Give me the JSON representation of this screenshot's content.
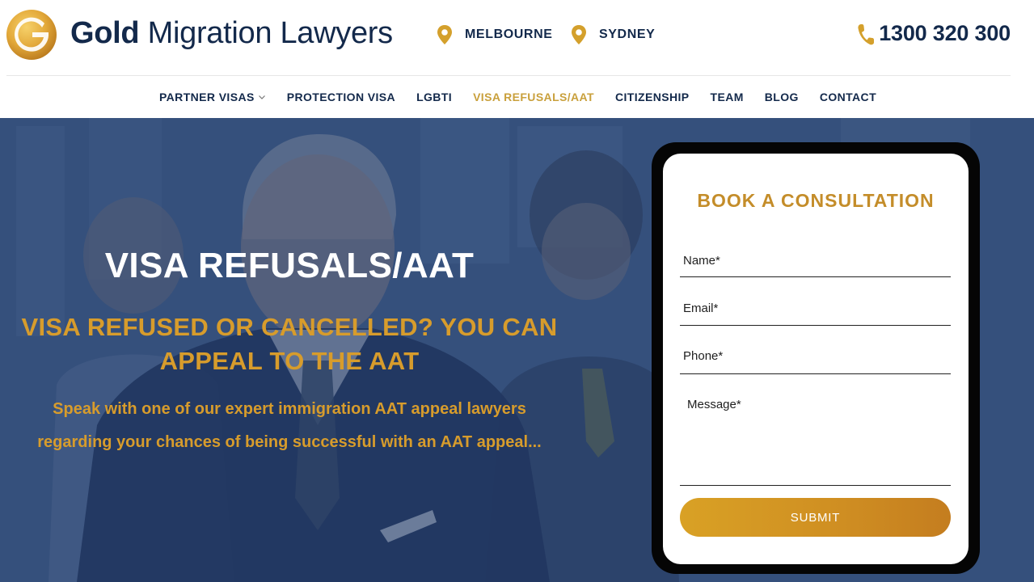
{
  "brand": {
    "name_bold": "Gold",
    "name_rest": "Migration Lawyers",
    "logo_letter": "G",
    "gold_color": "#d4a02c",
    "navy_color": "#13294b"
  },
  "locations": [
    {
      "icon": "map-pin-icon",
      "label": "MELBOURNE"
    },
    {
      "icon": "map-pin-icon",
      "label": "SYDNEY"
    }
  ],
  "phone": {
    "icon": "phone-icon",
    "number": "1300 320 300"
  },
  "nav": {
    "items": [
      {
        "label": "PARTNER VISAS",
        "has_dropdown": true,
        "active": false
      },
      {
        "label": "PROTECTION VISA",
        "active": false
      },
      {
        "label": "LGBTI",
        "active": false
      },
      {
        "label": "VISA REFUSALS/AAT",
        "active": true
      },
      {
        "label": "CITIZENSHIP",
        "active": false
      },
      {
        "label": "TEAM",
        "active": false
      },
      {
        "label": "BLOG",
        "active": false
      },
      {
        "label": "CONTACT",
        "active": false
      }
    ],
    "active_color": "#c9a03c"
  },
  "hero": {
    "title": "VISA REFUSALS/AAT",
    "subtitle_line1": "VISA REFUSED OR CANCELLED? YOU CAN",
    "subtitle_line2": "APPEAL TO THE AAT",
    "desc_line1": "Speak with one of our expert immigration AAT appeal lawyers",
    "desc_line2": "regarding your chances of being successful with an AAT appeal...",
    "accent_color": "#d79c2c"
  },
  "form": {
    "title": "BOOK A CONSULTATION",
    "fields": {
      "name": {
        "placeholder": "Name*",
        "value": ""
      },
      "email": {
        "placeholder": "Email*",
        "value": ""
      },
      "phone": {
        "placeholder": "Phone*",
        "value": ""
      },
      "message": {
        "placeholder": "Message*",
        "value": ""
      }
    },
    "submit_label": "SUBMIT"
  }
}
